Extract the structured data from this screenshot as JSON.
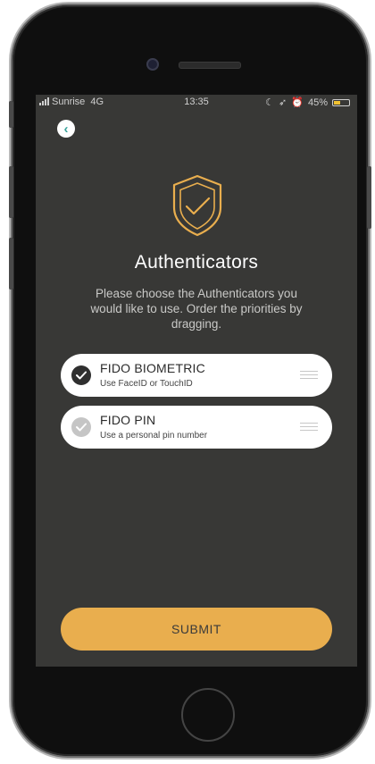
{
  "status_bar": {
    "carrier": "Sunrise",
    "network": "4G",
    "time": "13:35",
    "battery_percent_text": "45%",
    "battery_level": 0.45,
    "battery_color": "#f1c232",
    "indicators": [
      "moon-icon",
      "location-arrow-icon",
      "alarm-icon"
    ]
  },
  "nav": {
    "back_icon": "chevron-left-icon"
  },
  "header": {
    "icon": "shield-check-icon",
    "title": "Authenticators",
    "description": "Please choose the Authenticators you would like to use. Order the priorities by dragging."
  },
  "authenticators": [
    {
      "name": "FIDO BIOMETRIC",
      "description": "Use FaceID or TouchID",
      "selected": true
    },
    {
      "name": "FIDO PIN",
      "description": "Use a personal pin number",
      "selected": false
    }
  ],
  "submit_label": "SUBMIT",
  "colors": {
    "accent": "#e9ae4e",
    "screen_background": "#383836",
    "back_button_icon": "#3aa39b"
  }
}
